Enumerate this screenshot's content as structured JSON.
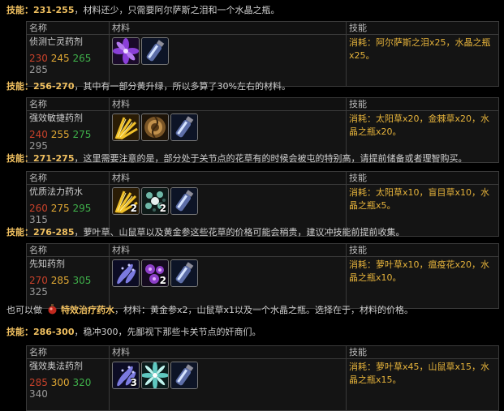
{
  "sections": [
    {
      "skill_label": "技能：",
      "range": "231-255",
      "text": "，材料还少，只需要阿尔萨斯之泪和一个水晶之瓶。",
      "headers": [
        "名称",
        "材料",
        "技能"
      ],
      "recipe": "侦测亡灵药剂",
      "levels": [
        "230",
        "245",
        "265",
        "285"
      ],
      "cost": "消耗：阿尔萨斯之泪x25，水晶之瓶x25。",
      "materials": [
        {
          "icon": "arthas-tears-icon",
          "count": ""
        },
        {
          "icon": "crystal-vial-icon",
          "count": ""
        }
      ]
    },
    {
      "skill_label": "技能：",
      "range": "256-270",
      "text": "，其中有一部分黄升绿，所以多算了30%左右的材料。",
      "headers": [
        "名称",
        "材料",
        "技能"
      ],
      "recipe": "强效敏捷药剂",
      "levels": [
        "240",
        "255",
        "275",
        "295"
      ],
      "cost": "消耗：太阳草x20，金棘草x20，水晶之瓶x20。",
      "materials": [
        {
          "icon": "sungrass-icon",
          "count": ""
        },
        {
          "icon": "goldthorn-icon",
          "count": ""
        },
        {
          "icon": "crystal-vial-icon",
          "count": ""
        }
      ]
    },
    {
      "skill_label": "技能：",
      "range": "271-275",
      "text": "，这里需要注意的是，部分处于关节点的花草有的时候会被屯的特别高，请提前储备或者理智购买。",
      "headers": [
        "名称",
        "材料",
        "技能"
      ],
      "recipe": "优质法力药水",
      "levels": [
        "260",
        "275",
        "295",
        "315"
      ],
      "cost": "消耗：太阳草x10，盲目草x10，水晶之瓶x5。",
      "materials": [
        {
          "icon": "sungrass-icon",
          "count": "2"
        },
        {
          "icon": "blindweed-icon",
          "count": "2"
        },
        {
          "icon": "crystal-vial-icon",
          "count": ""
        }
      ]
    },
    {
      "skill_label": "技能：",
      "range": "276-285",
      "text": "，萝叶草、山鼠草以及黄金参这些花草的价格可能会稍贵，建议冲技能前提前收集。",
      "headers": [
        "名称",
        "材料",
        "技能"
      ],
      "recipe": "先知药剂",
      "levels": [
        "270",
        "285",
        "305",
        "325"
      ],
      "cost": "消耗：萝叶草x10，瘟疫花x20，水晶之瓶x10。",
      "materials": [
        {
          "icon": "dreamfoil-icon",
          "count": ""
        },
        {
          "icon": "plaguebloom-icon",
          "count": "2"
        },
        {
          "icon": "crystal-vial-icon",
          "count": ""
        }
      ]
    },
    {
      "skill_label": "技能：",
      "range": "286-300",
      "text": "，稳冲300，先鄙视下那些卡关节点的奸商们。",
      "headers": [
        "名称",
        "材料",
        "技能"
      ],
      "recipe": "强效奥法药剂",
      "levels": [
        "285",
        "300",
        "320",
        "340"
      ],
      "cost": "消耗：萝叶草x45，山鼠草x15，水晶之瓶x15。",
      "materials": [
        {
          "icon": "dreamfoil-icon",
          "count": "3"
        },
        {
          "icon": "mountain-silversage-icon",
          "count": ""
        },
        {
          "icon": "crystal-vial-icon",
          "count": ""
        }
      ]
    }
  ],
  "note": {
    "prefix": "也可以做",
    "potion": "特效治疗药水",
    "suffix": "，材料：黄金参x2，山鼠草x1以及一个水晶之瓶。选择在于，材料的价格。"
  }
}
